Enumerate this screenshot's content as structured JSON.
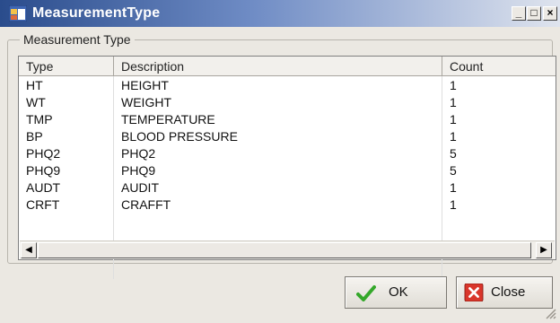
{
  "window": {
    "title": "MeasurementType",
    "controls": {
      "minimize": "_",
      "maximize": "□",
      "close": "×"
    }
  },
  "group": {
    "legend": "Measurement Type"
  },
  "grid": {
    "columns": [
      "Type",
      "Description",
      "Count"
    ],
    "rows": [
      [
        "HT",
        "HEIGHT",
        "1"
      ],
      [
        "WT",
        "WEIGHT",
        "1"
      ],
      [
        "TMP",
        "TEMPERATURE",
        "1"
      ],
      [
        "BP",
        "BLOOD PRESSURE",
        "1"
      ],
      [
        "PHQ2",
        "PHQ2",
        "5"
      ],
      [
        "PHQ9",
        "PHQ9",
        "5"
      ],
      [
        "AUDT",
        "AUDIT",
        "1"
      ],
      [
        "CRFT",
        "CRAFFT",
        "1"
      ]
    ]
  },
  "scrollbar": {
    "left_arrow": "◀",
    "right_arrow": "▶"
  },
  "buttons": {
    "ok_label": "OK",
    "close_label": "Close"
  },
  "icons": {
    "app": "app-window-icon",
    "ok": "check-icon",
    "close": "x-icon",
    "grip": "resize-grip-icon"
  },
  "colors": {
    "ok_check": "#34a82a",
    "close_red": "#d9362b",
    "title_bar": "#2a4c8c"
  }
}
